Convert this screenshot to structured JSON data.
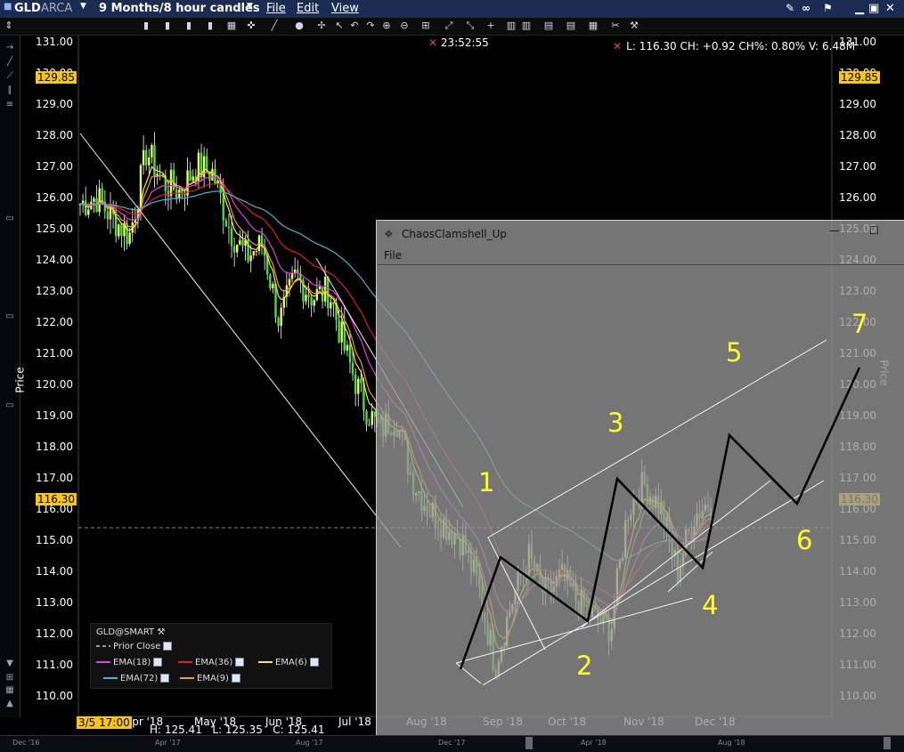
{
  "titlebar": {
    "symbol": "GLD",
    "exchange": "ARCA",
    "period": "9 Months/8 hour candles",
    "menu": [
      "File",
      "Edit",
      "View"
    ]
  },
  "chart": {
    "time_label": "23:52:55",
    "stats": "L: 116.30 CH: +0.92 CH%: 0.80% V: 6.48M",
    "y_axis_label": "Price",
    "y_ticks": [
      "131.00",
      "130.00",
      "129.00",
      "128.00",
      "127.00",
      "126.00",
      "125.00",
      "124.00",
      "123.00",
      "122.00",
      "121.00",
      "120.00",
      "119.00",
      "118.00",
      "117.00",
      "116.00",
      "115.00",
      "114.00",
      "113.00",
      "112.00",
      "111.00",
      "110.00"
    ],
    "high_tag": "129.85",
    "last_tag": "116.30",
    "x_labels": [
      "Apr '18",
      "May '18",
      "Jun '18",
      "Jul '18",
      "Aug '18",
      "Sep '18",
      "Oct '18",
      "Nov '18",
      "Dec '18"
    ],
    "cursor_date": "3/5 17:00",
    "ohlc": "H: 125.41   L: 125.35   C: 125.41"
  },
  "legend": {
    "symbol": "GLD@SMART",
    "prior_close": "Prior Close",
    "ema18": "EMA(18)",
    "ema36": "EMA(36)",
    "ema6": "EMA(6)",
    "ema72": "EMA(72)",
    "ema9": "EMA(9)",
    "colors": {
      "ema18": "#e040e0",
      "ema36": "#e02020",
      "ema6": "#f0f040",
      "ema72": "#40b8e0",
      "ema9": "#f0a030"
    }
  },
  "overlay": {
    "title": "ChaosClamshell_Up",
    "menu": "File",
    "wave_labels": [
      "1",
      "2",
      "3",
      "4",
      "5",
      "6",
      "7"
    ]
  },
  "navigator": {
    "labels": [
      "Dec '16",
      "Apr '17",
      "Aug '17",
      "Dec '17",
      "Apr '18",
      "Aug '18"
    ]
  },
  "chart_data": {
    "type": "candlestick",
    "ylabel": "Price",
    "ylim": [
      110,
      131
    ],
    "x": [
      "Apr '18",
      "May '18",
      "Jun '18",
      "Jul '18",
      "Aug '18",
      "Sep '18",
      "Oct '18",
      "Nov '18",
      "Dec '18"
    ],
    "close_path": [
      125.8,
      126.0,
      125.3,
      124.8,
      127.5,
      126.5,
      126.2,
      127.0,
      126.8,
      125.0,
      124.1,
      124.5,
      122.0,
      123.5,
      122.8,
      123.0,
      121.0,
      119.5,
      118.5,
      119.0,
      117.0,
      116.0,
      115.5,
      115.0,
      113.5,
      111.0,
      113.0,
      114.5,
      113.2,
      113.8,
      113.0,
      112.5,
      112.2,
      116.0,
      116.8,
      116.0,
      114.0,
      115.8,
      116.3
    ],
    "wave_points": [
      {
        "label": "1",
        "price": 114.5
      },
      {
        "label": "2",
        "price": 112.3
      },
      {
        "label": "3",
        "price": 117.0
      },
      {
        "label": "4",
        "price": 114.1
      },
      {
        "label": "5",
        "price": 118.3
      },
      {
        "label": "6",
        "price": 116.2
      },
      {
        "label": "7",
        "price": 120.5
      }
    ]
  }
}
